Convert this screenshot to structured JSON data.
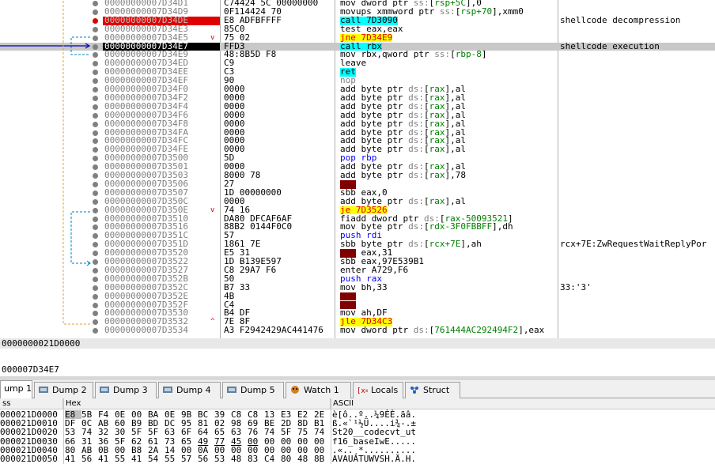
{
  "disasm": {
    "rows": [
      {
        "addr": "00000000007D34D1",
        "bytes": "C74424 5C 00000000",
        "instr": [
          [
            "m-norm",
            "mov dword ptr "
          ],
          [
            "m-seg",
            "ss:"
          ],
          [
            "m-br",
            "["
          ],
          [
            "m-reg",
            "rsp+5C"
          ],
          [
            "m-br",
            "]"
          ],
          [
            "m-norm",
            ",0"
          ]
        ],
        "comment": "",
        "bp": "gray",
        "style": ""
      },
      {
        "addr": "00000000007D34D9",
        "bytes": "0F114424 70",
        "instr": [
          [
            "m-norm",
            "movups xmmword ptr "
          ],
          [
            "m-seg",
            "ss:"
          ],
          [
            "m-br",
            "["
          ],
          [
            "m-reg",
            "rsp+70"
          ],
          [
            "m-br",
            "]"
          ],
          [
            "m-norm",
            ",xmm0"
          ]
        ],
        "comment": "",
        "bp": "gray",
        "style": ""
      },
      {
        "addr": "00000000007D34DE",
        "bytes": "E8 ADFBFFFF",
        "instr": [
          [
            "m-call",
            "call 7D3090"
          ]
        ],
        "comment": "shellcode decompression",
        "bp": "red",
        "style": "bpaddr"
      },
      {
        "addr": "00000000007D34E3",
        "bytes": "85C0",
        "instr": [
          [
            "m-norm",
            "test eax,eax"
          ]
        ],
        "comment": "",
        "bp": "gray",
        "style": ""
      },
      {
        "addr": "00000000007D34E5",
        "bytes": "75 02",
        "instr": [
          [
            "m-jmp",
            "jne 7D34E9"
          ]
        ],
        "comment": "",
        "bp": "gray",
        "style": "",
        "mark": "v"
      },
      {
        "addr": "00000000007D34E7",
        "bytes": "FFD3",
        "instr": [
          [
            "m-call",
            "call rbx"
          ]
        ],
        "comment": "shellcode execution",
        "bp": "gray",
        "style": "rip",
        "cur": true
      },
      {
        "addr": "00000000007D34E9",
        "bytes": "48:8B5D F8",
        "instr": [
          [
            "m-norm",
            "mov rbx,qword ptr "
          ],
          [
            "m-seg",
            "ss:"
          ],
          [
            "m-br",
            "["
          ],
          [
            "m-reg",
            "rbp-8"
          ],
          [
            "m-br",
            "]"
          ]
        ],
        "comment": "",
        "bp": "gray",
        "style": ""
      },
      {
        "addr": "00000000007D34ED",
        "bytes": "C9",
        "instr": [
          [
            "m-norm",
            "leave"
          ]
        ],
        "comment": "",
        "bp": "gray",
        "style": ""
      },
      {
        "addr": "00000000007D34EE",
        "bytes": "C3",
        "instr": [
          [
            "m-ret",
            "ret"
          ]
        ],
        "comment": "",
        "bp": "gray",
        "style": ""
      },
      {
        "addr": "00000000007D34EF",
        "bytes": "90",
        "instr": [
          [
            "m-nop",
            "nop"
          ]
        ],
        "comment": "",
        "bp": "gray",
        "style": ""
      },
      {
        "addr": "00000000007D34F0",
        "bytes": "0000",
        "instr": [
          [
            "m-norm",
            "add byte ptr "
          ],
          [
            "m-seg",
            "ds:"
          ],
          [
            "m-br",
            "["
          ],
          [
            "m-reg",
            "rax"
          ],
          [
            "m-br",
            "]"
          ],
          [
            "m-norm",
            ",al"
          ]
        ],
        "comment": "",
        "bp": "gray",
        "style": ""
      },
      {
        "addr": "00000000007D34F2",
        "bytes": "0000",
        "instr": [
          [
            "m-norm",
            "add byte ptr "
          ],
          [
            "m-seg",
            "ds:"
          ],
          [
            "m-br",
            "["
          ],
          [
            "m-reg",
            "rax"
          ],
          [
            "m-br",
            "]"
          ],
          [
            "m-norm",
            ",al"
          ]
        ],
        "comment": "",
        "bp": "gray",
        "style": ""
      },
      {
        "addr": "00000000007D34F4",
        "bytes": "0000",
        "instr": [
          [
            "m-norm",
            "add byte ptr "
          ],
          [
            "m-seg",
            "ds:"
          ],
          [
            "m-br",
            "["
          ],
          [
            "m-reg",
            "rax"
          ],
          [
            "m-br",
            "]"
          ],
          [
            "m-norm",
            ",al"
          ]
        ],
        "comment": "",
        "bp": "gray",
        "style": ""
      },
      {
        "addr": "00000000007D34F6",
        "bytes": "0000",
        "instr": [
          [
            "m-norm",
            "add byte ptr "
          ],
          [
            "m-seg",
            "ds:"
          ],
          [
            "m-br",
            "["
          ],
          [
            "m-reg",
            "rax"
          ],
          [
            "m-br",
            "]"
          ],
          [
            "m-norm",
            ",al"
          ]
        ],
        "comment": "",
        "bp": "gray",
        "style": ""
      },
      {
        "addr": "00000000007D34F8",
        "bytes": "0000",
        "instr": [
          [
            "m-norm",
            "add byte ptr "
          ],
          [
            "m-seg",
            "ds:"
          ],
          [
            "m-br",
            "["
          ],
          [
            "m-reg",
            "rax"
          ],
          [
            "m-br",
            "]"
          ],
          [
            "m-norm",
            ",al"
          ]
        ],
        "comment": "",
        "bp": "gray",
        "style": ""
      },
      {
        "addr": "00000000007D34FA",
        "bytes": "0000",
        "instr": [
          [
            "m-norm",
            "add byte ptr "
          ],
          [
            "m-seg",
            "ds:"
          ],
          [
            "m-br",
            "["
          ],
          [
            "m-reg",
            "rax"
          ],
          [
            "m-br",
            "]"
          ],
          [
            "m-norm",
            ",al"
          ]
        ],
        "comment": "",
        "bp": "gray",
        "style": ""
      },
      {
        "addr": "00000000007D34FC",
        "bytes": "0000",
        "instr": [
          [
            "m-norm",
            "add byte ptr "
          ],
          [
            "m-seg",
            "ds:"
          ],
          [
            "m-br",
            "["
          ],
          [
            "m-reg",
            "rax"
          ],
          [
            "m-br",
            "]"
          ],
          [
            "m-norm",
            ",al"
          ]
        ],
        "comment": "",
        "bp": "gray",
        "style": ""
      },
      {
        "addr": "00000000007D34FE",
        "bytes": "0000",
        "instr": [
          [
            "m-norm",
            "add byte ptr "
          ],
          [
            "m-seg",
            "ds:"
          ],
          [
            "m-br",
            "["
          ],
          [
            "m-reg",
            "rax"
          ],
          [
            "m-br",
            "]"
          ],
          [
            "m-norm",
            ",al"
          ]
        ],
        "comment": "",
        "bp": "gray",
        "style": ""
      },
      {
        "addr": "00000000007D3500",
        "bytes": "5D",
        "instr": [
          [
            "m-pop",
            "pop rbp"
          ]
        ],
        "comment": "",
        "bp": "gray",
        "style": ""
      },
      {
        "addr": "00000000007D3501",
        "bytes": "0000",
        "instr": [
          [
            "m-norm",
            "add byte ptr "
          ],
          [
            "m-seg",
            "ds:"
          ],
          [
            "m-br",
            "["
          ],
          [
            "m-reg",
            "rax"
          ],
          [
            "m-br",
            "]"
          ],
          [
            "m-norm",
            ",al"
          ]
        ],
        "comment": "",
        "bp": "gray",
        "style": ""
      },
      {
        "addr": "00000000007D3503",
        "bytes": "8000 78",
        "instr": [
          [
            "m-norm",
            "add byte ptr "
          ],
          [
            "m-seg",
            "ds:"
          ],
          [
            "m-br",
            "["
          ],
          [
            "m-reg",
            "rax"
          ],
          [
            "m-br",
            "]"
          ],
          [
            "m-norm",
            ",78"
          ]
        ],
        "comment": "",
        "bp": "gray",
        "style": ""
      },
      {
        "addr": "00000000007D3506",
        "bytes": "27",
        "instr": [
          [
            "m-bad",
            "???"
          ]
        ],
        "comment": "",
        "bp": "gray",
        "style": ""
      },
      {
        "addr": "00000000007D3507",
        "bytes": "1D 00000000",
        "instr": [
          [
            "m-norm",
            "sbb eax,0"
          ]
        ],
        "comment": "",
        "bp": "gray",
        "style": ""
      },
      {
        "addr": "00000000007D350C",
        "bytes": "0000",
        "instr": [
          [
            "m-norm",
            "add byte ptr "
          ],
          [
            "m-seg",
            "ds:"
          ],
          [
            "m-br",
            "["
          ],
          [
            "m-reg",
            "rax"
          ],
          [
            "m-br",
            "]"
          ],
          [
            "m-norm",
            ",al"
          ]
        ],
        "comment": "",
        "bp": "gray",
        "style": ""
      },
      {
        "addr": "00000000007D350E",
        "bytes": "74 16",
        "instr": [
          [
            "m-jmp",
            "je 7D3526"
          ]
        ],
        "comment": "",
        "bp": "gray",
        "style": "",
        "mark": "v"
      },
      {
        "addr": "00000000007D3510",
        "bytes": "DA80 DFCAF6AF",
        "instr": [
          [
            "m-norm",
            "fiadd dword ptr "
          ],
          [
            "m-seg",
            "ds:"
          ],
          [
            "m-br",
            "["
          ],
          [
            "m-reg",
            "rax-50093521"
          ],
          [
            "m-br",
            "]"
          ]
        ],
        "comment": "",
        "bp": "gray",
        "style": ""
      },
      {
        "addr": "00000000007D3516",
        "bytes": "88B2 0144F0C0",
        "instr": [
          [
            "m-norm",
            "mov byte ptr "
          ],
          [
            "m-seg",
            "ds:"
          ],
          [
            "m-br",
            "["
          ],
          [
            "m-reg",
            "rdx-3F0FBBFF"
          ],
          [
            "m-br",
            "]"
          ],
          [
            "m-norm",
            ",dh"
          ]
        ],
        "comment": "",
        "bp": "gray",
        "style": ""
      },
      {
        "addr": "00000000007D351C",
        "bytes": "57",
        "instr": [
          [
            "m-push",
            "push rdi"
          ]
        ],
        "comment": "",
        "bp": "gray",
        "style": ""
      },
      {
        "addr": "00000000007D351D",
        "bytes": "1861 7E",
        "instr": [
          [
            "m-norm",
            "sbb byte ptr "
          ],
          [
            "m-seg",
            "ds:"
          ],
          [
            "m-br",
            "["
          ],
          [
            "m-reg",
            "rcx+7E"
          ],
          [
            "m-br",
            "]"
          ],
          [
            "m-norm",
            ",ah"
          ]
        ],
        "comment": "rcx+7E:ZwRequestWaitReplyPor",
        "bp": "gray",
        "style": ""
      },
      {
        "addr": "00000000007D3520",
        "bytes": "E5 31",
        "instr": [
          [
            "m-bad",
            "in "
          ],
          [
            "m-norm",
            " eax,31"
          ]
        ],
        "comment": "",
        "bp": "gray",
        "style": ""
      },
      {
        "addr": "00000000007D3522",
        "bytes": "1D B139E597",
        "instr": [
          [
            "m-norm",
            "sbb eax,97E539B1"
          ]
        ],
        "comment": "",
        "bp": "gray",
        "style": ""
      },
      {
        "addr": "00000000007D3527",
        "bytes": "C8 29A7 F6",
        "instr": [
          [
            "m-norm",
            "enter A729,F6"
          ]
        ],
        "comment": "",
        "bp": "gray",
        "style": ""
      },
      {
        "addr": "00000000007D352B",
        "bytes": "50",
        "instr": [
          [
            "m-push",
            "push rax"
          ]
        ],
        "comment": "",
        "bp": "gray",
        "style": ""
      },
      {
        "addr": "00000000007D352C",
        "bytes": "B7 33",
        "instr": [
          [
            "m-norm",
            "mov bh,33"
          ]
        ],
        "comment": "33:'3'",
        "bp": "gray",
        "style": ""
      },
      {
        "addr": "00000000007D352E",
        "bytes": "4B",
        "instr": [
          [
            "m-bad",
            "???"
          ]
        ],
        "comment": "",
        "bp": "gray",
        "style": ""
      },
      {
        "addr": "00000000007D352F",
        "bytes": "C4",
        "instr": [
          [
            "m-bad",
            "???"
          ]
        ],
        "comment": "",
        "bp": "gray",
        "style": ""
      },
      {
        "addr": "00000000007D3530",
        "bytes": "B4 DF",
        "instr": [
          [
            "m-norm",
            "mov ah,DF"
          ]
        ],
        "comment": "",
        "bp": "gray",
        "style": ""
      },
      {
        "addr": "00000000007D3532",
        "bytes": "7E 8F",
        "instr": [
          [
            "m-jmp",
            "jle 7D34C3"
          ]
        ],
        "comment": "",
        "bp": "gray",
        "style": "",
        "mark": "^"
      },
      {
        "addr": "00000000007D3534",
        "bytes": "A3 F2942429AC441476",
        "instr": [
          [
            "m-norm",
            "mov dword ptr "
          ],
          [
            "m-seg",
            "ds:"
          ],
          [
            "m-br",
            "["
          ],
          [
            "m-reg",
            "761444AC292494F2"
          ],
          [
            "m-br",
            "]"
          ],
          [
            "m-norm",
            ",eax"
          ]
        ],
        "comment": "",
        "bp": "gray",
        "style": ""
      }
    ]
  },
  "info": {
    "line1": "0000000021D0000",
    "line2": "000007D34E7"
  },
  "tabs": [
    {
      "label": "ump 1",
      "icon": "dump-icon",
      "active": true
    },
    {
      "label": "Dump 2",
      "icon": "dump-icon"
    },
    {
      "label": "Dump 3",
      "icon": "dump-icon"
    },
    {
      "label": "Dump 4",
      "icon": "dump-icon"
    },
    {
      "label": "Dump 5",
      "icon": "dump-icon"
    },
    {
      "label": "Watch 1",
      "icon": "watch-icon"
    },
    {
      "label": "Locals",
      "icon": "locals-icon"
    },
    {
      "label": "Struct",
      "icon": "struct-icon"
    }
  ],
  "dump": {
    "headers": {
      "address": "ss",
      "hex": "Hex",
      "ascii": "ASCII"
    },
    "rows": [
      {
        "addr": "000021D0000",
        "hex": [
          "E8",
          "5B",
          "F4",
          "0E",
          "00",
          "BA",
          "0E",
          "9B",
          "BC",
          "39",
          "C8",
          "C8",
          "13",
          "E3",
          "E2",
          "2E"
        ],
        "ascii": "è[ô..º..¼9ÈÈ.ãâ."
      },
      {
        "addr": "000021D0010",
        "hex": [
          "DF",
          "0C",
          "AB",
          "60",
          "B9",
          "BD",
          "DC",
          "95",
          "81",
          "02",
          "98",
          "69",
          "BE",
          "2D",
          "8D",
          "B1"
        ],
        "ascii": "ß.«`¹½Ü....i¾-.±"
      },
      {
        "addr": "000021D0020",
        "hex": [
          "53",
          "74",
          "32",
          "30",
          "5F",
          "5F",
          "63",
          "6F",
          "64",
          "65",
          "63",
          "76",
          "74",
          "5F",
          "75",
          "74"
        ],
        "ascii": "St20__codecvt_ut"
      },
      {
        "addr": "000021D0030",
        "hex": [
          "66",
          "31",
          "36",
          "5F",
          "62",
          "61",
          "73",
          "65",
          "49",
          "77",
          "45",
          "00",
          "00",
          "00",
          "00",
          "00"
        ],
        "ascii": "f16_baseIwE....."
      },
      {
        "addr": "000021D0040",
        "hex": [
          "80",
          "AB",
          "0B",
          "00",
          "B8",
          "2A",
          "14",
          "00",
          "0A",
          "00",
          "00",
          "00",
          "00",
          "00",
          "00",
          "00"
        ],
        "ascii": ".«..¸*.........."
      },
      {
        "addr": "000021D0050",
        "hex": [
          "41",
          "56",
          "41",
          "55",
          "41",
          "54",
          "55",
          "57",
          "56",
          "53",
          "48",
          "83",
          "C4",
          "80",
          "48",
          "8B"
        ],
        "ascii": "AVAUATUWVSH.Ä.H."
      }
    ]
  }
}
